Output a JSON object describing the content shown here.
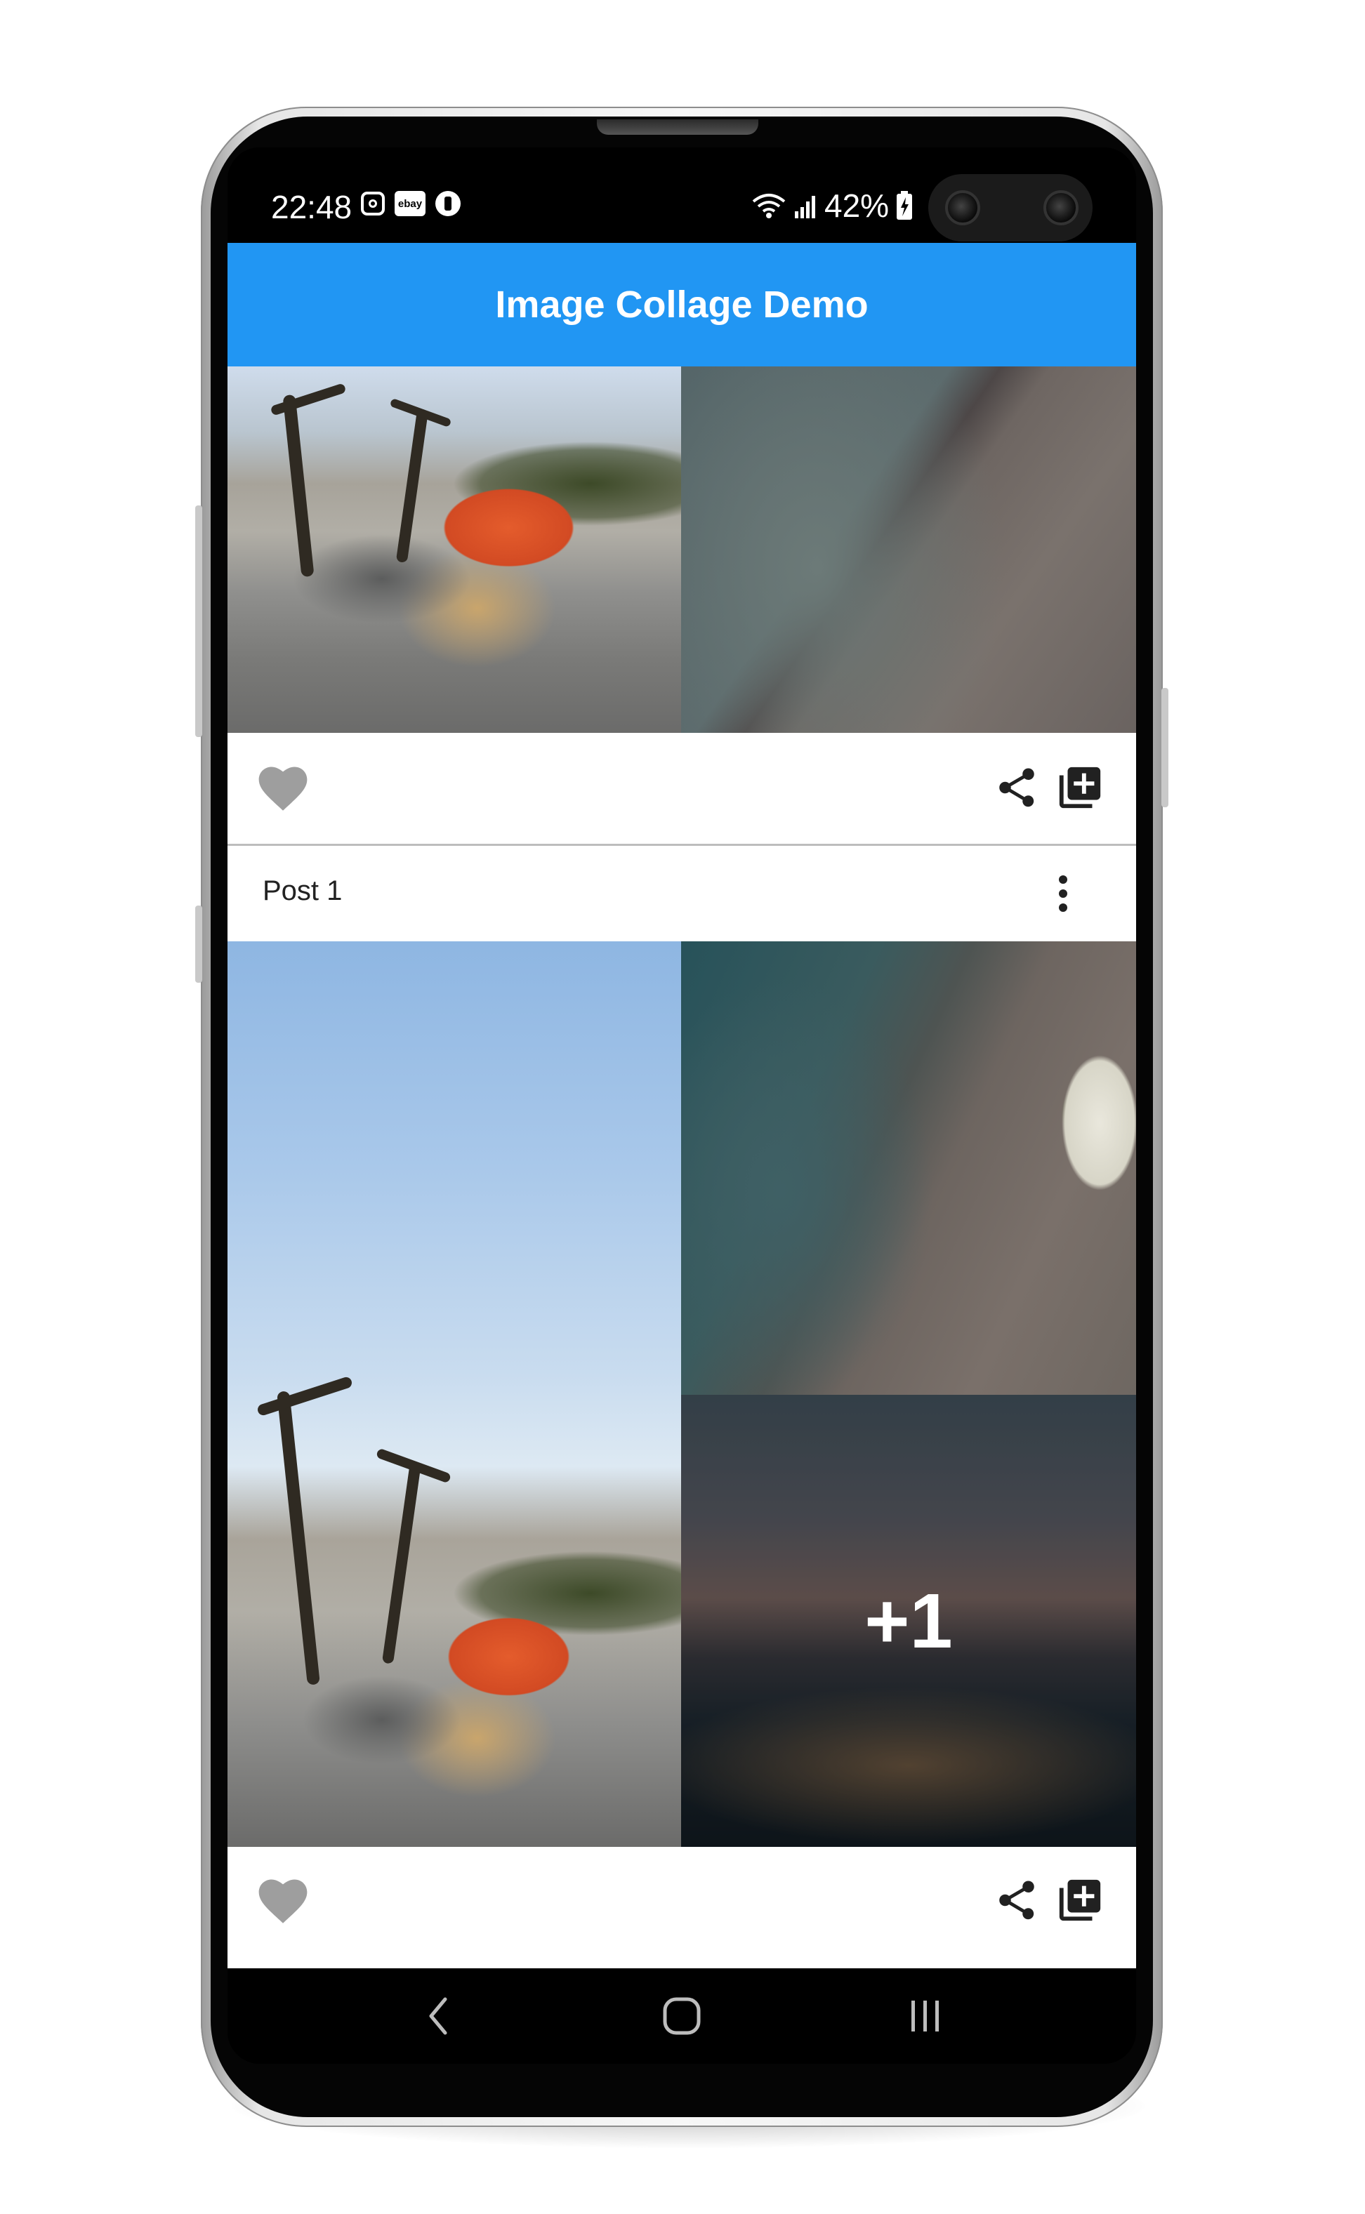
{
  "status_bar": {
    "time": "22:48",
    "notification_icons": [
      "instagram-icon",
      "ebay-icon",
      "app-icon"
    ],
    "battery_percent": "42%"
  },
  "app_bar": {
    "title": "Image Collage Demo"
  },
  "posts": [
    {
      "title": "",
      "images": [
        "desert-camp-photo",
        "shoreline-photo"
      ],
      "more_count": "",
      "actions": [
        "favorite-icon",
        "share-icon",
        "add-collection-icon"
      ]
    },
    {
      "title": "Post 1",
      "images": [
        "desert-camp-photo",
        "shoreline-island-photo",
        "city-skyline-photo"
      ],
      "more_count": "+1",
      "actions": [
        "favorite-icon",
        "share-icon",
        "add-collection-icon"
      ]
    }
  ],
  "nav_bar": [
    "back-icon",
    "home-icon",
    "recents-icon"
  ],
  "colors": {
    "app_bar": "#2196f3",
    "favorite_icon": "#9e9e9e",
    "action_icon": "#212121"
  }
}
